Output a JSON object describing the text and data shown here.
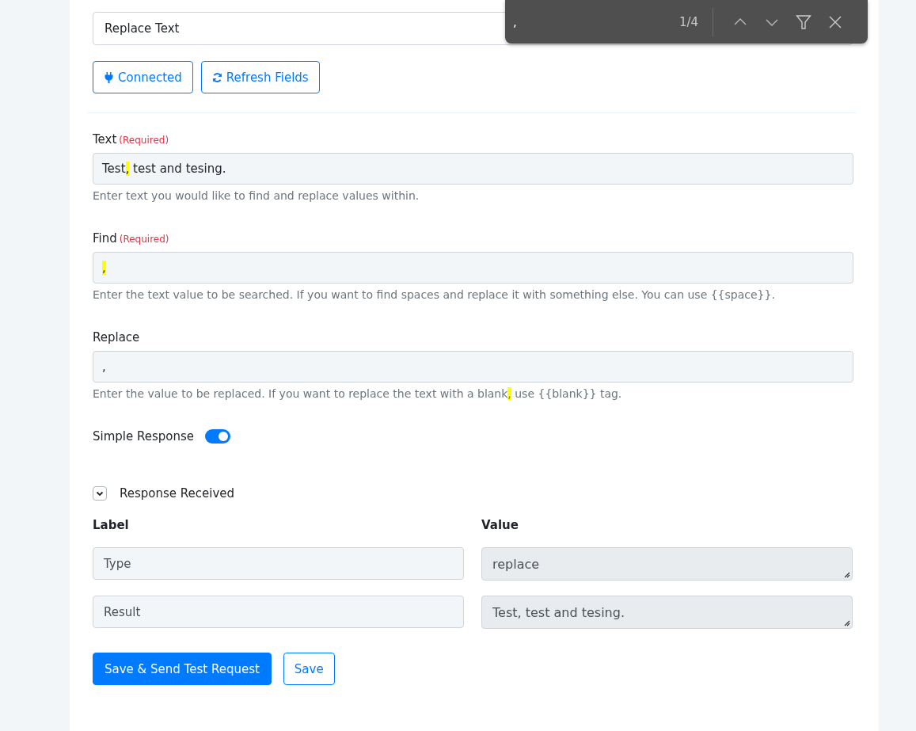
{
  "find_bar": {
    "query": ",",
    "count": "1/4"
  },
  "action_event": {
    "value": "Replace Text"
  },
  "top_buttons": [
    {
      "label": "Connected"
    },
    {
      "label": "Refresh Fields"
    }
  ],
  "fields": [
    {
      "label": "Text",
      "required_note": "(Required)",
      "value": [
        {
          "text": "Test"
        },
        {
          "text": ",",
          "highlighted": true
        },
        {
          "text": " test and tesing."
        }
      ],
      "hint": [
        {
          "text": "Enter text you would like to find and replace values within."
        }
      ]
    },
    {
      "label": "Find",
      "required_note": "(Required)",
      "value": [
        {
          "text": ",",
          "highlighted": true
        }
      ],
      "hint": [
        {
          "text": "Enter the text value to be searched. If you want to find spaces and replace it with something else. You can use {{space}}."
        }
      ]
    },
    {
      "label": "Replace",
      "value": [
        {
          "text": ","
        }
      ],
      "hint": [
        {
          "text": "Enter the value to be replaced. If you want to replace the text with a blank"
        },
        {
          "text": ",",
          "highlighted": true
        },
        {
          "text": " use {{blank}} tag."
        }
      ]
    }
  ],
  "simple_response": {
    "label": "Simple Response",
    "on": true
  },
  "response": {
    "title": "Response Received",
    "expanded": true,
    "columns": [
      "Label",
      "Value"
    ],
    "rows": [
      {
        "label": "Type",
        "value": "replace"
      },
      {
        "label": "Result",
        "value": "Test, test and tesing."
      }
    ]
  },
  "actions": [
    {
      "label": "Save & Send Test Request",
      "kind": "primary"
    },
    {
      "label": "Save",
      "kind": "outline"
    }
  ]
}
